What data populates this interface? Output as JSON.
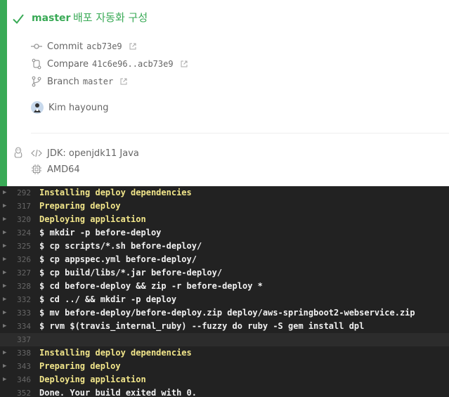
{
  "build": {
    "branch": "master",
    "message": "배포 자동화 구성",
    "status_color": "#39aa56",
    "commit": {
      "label": "Commit",
      "value": "acb73e9"
    },
    "compare": {
      "label": "Compare",
      "value": "41c6e96..acb73e9"
    },
    "branch_link": {
      "label": "Branch",
      "value": "master"
    },
    "author": "Kim hayoung"
  },
  "environment": {
    "language": "JDK: openjdk11 Java",
    "arch": "AMD64"
  },
  "icons": {
    "status": "check-icon",
    "commit": "commit-icon",
    "compare": "compare-icon",
    "branch": "branch-icon",
    "external": "external-link-icon",
    "os": "linux-icon",
    "language": "code-icon",
    "arch": "cpu-icon"
  },
  "log": [
    {
      "num": "292",
      "text": "Installing deploy dependencies",
      "style": "yellow",
      "fold": true
    },
    {
      "num": "317",
      "text": "Preparing deploy",
      "style": "yellow",
      "fold": true
    },
    {
      "num": "320",
      "text": "Deploying application",
      "style": "yellow",
      "fold": true
    },
    {
      "num": "324",
      "text": "$ mkdir -p before-deploy",
      "style": "bold",
      "fold": true
    },
    {
      "num": "325",
      "text": "$ cp scripts/*.sh before-deploy/",
      "style": "bold",
      "fold": true
    },
    {
      "num": "326",
      "text": "$ cp appspec.yml before-deploy/",
      "style": "bold",
      "fold": true
    },
    {
      "num": "327",
      "text": "$ cp build/libs/*.jar before-deploy/",
      "style": "bold",
      "fold": true
    },
    {
      "num": "328",
      "text": "$ cd before-deploy && zip -r before-deploy *",
      "style": "bold",
      "fold": true
    },
    {
      "num": "332",
      "text": "$ cd ../ && mkdir -p deploy",
      "style": "bold",
      "fold": true
    },
    {
      "num": "333",
      "text": "$ mv before-deploy/before-deploy.zip deploy/aws-springboot2-webservice.zip",
      "style": "bold",
      "fold": true
    },
    {
      "num": "334",
      "text": "$ rvm $(travis_internal_ruby) --fuzzy do ruby -S gem install dpl",
      "style": "bold",
      "fold": true
    },
    {
      "num": "337",
      "text": "",
      "style": "blank",
      "fold": false
    },
    {
      "num": "338",
      "text": "Installing deploy dependencies",
      "style": "yellow",
      "fold": true
    },
    {
      "num": "343",
      "text": "Preparing deploy",
      "style": "yellow",
      "fold": true
    },
    {
      "num": "346",
      "text": "Deploying application",
      "style": "yellow",
      "fold": true
    },
    {
      "num": "352",
      "text": "Done. Your build exited with 0.",
      "style": "bold",
      "fold": false
    }
  ]
}
